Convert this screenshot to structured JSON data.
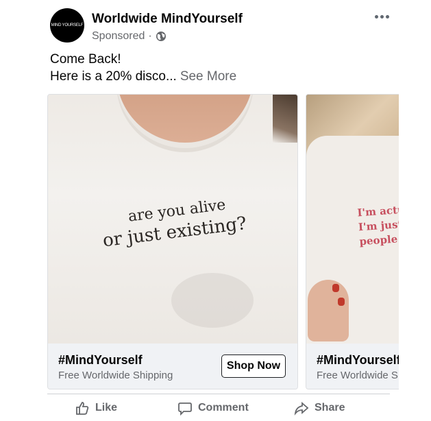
{
  "post": {
    "avatar_text": "MIND YOURSELF",
    "page_name": "Worldwide MindYourself",
    "meta": {
      "sponsored": "Sponsored",
      "separator": "·"
    },
    "text": {
      "line1": "Come Back!",
      "line2": "Here is a 20% disco...",
      "see_more": "See More"
    }
  },
  "carousel": [
    {
      "image_text_line1": "are you alive",
      "image_text_line2": "or just existing?",
      "title": "#MindYourself",
      "subtitle": "Free Worldwide Shipping",
      "cta": "Shop Now"
    },
    {
      "image_text_lines": [
        "I'm actu",
        "I'm just",
        "people"
      ],
      "title": "#MindYourself",
      "subtitle": "Free Worldwide S"
    }
  ],
  "actions": {
    "like": "Like",
    "comment": "Comment",
    "share": "Share"
  },
  "colors": {
    "text": "#050505",
    "secondary": "#65676b",
    "card_bg": "#f0f2f5",
    "shirt_print": "#c7505f"
  },
  "icons": [
    "globe-icon",
    "more-options-icon",
    "like-icon",
    "comment-icon",
    "share-icon"
  ]
}
